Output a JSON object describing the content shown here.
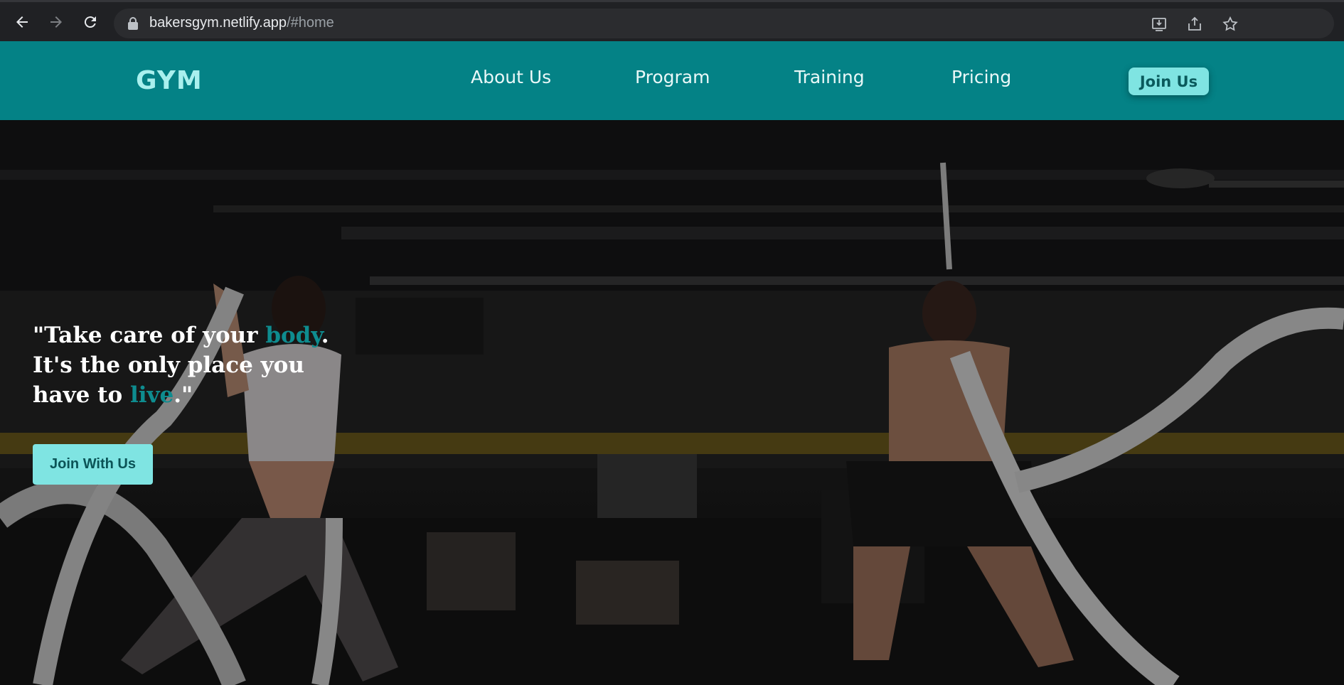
{
  "browser": {
    "url_host": "bakersgym.netlify.app",
    "url_path": "/#home"
  },
  "header": {
    "logo": "GYM",
    "nav": [
      {
        "label": "About Us"
      },
      {
        "label": "Program"
      },
      {
        "label": "Training"
      },
      {
        "label": "Pricing"
      }
    ],
    "join_button": "Join Us"
  },
  "hero": {
    "quote": {
      "line1_pre": "\"Take care of your ",
      "line1_hl": "body",
      "line1_post": ".",
      "line2": "It's the only place you",
      "line3_pre": "have to ",
      "line3_hl": "live",
      "line3_post": ".\""
    },
    "cta_label": "Join With Us"
  },
  "colors": {
    "header_bg": "#048286",
    "accent": "#7fe4e2",
    "highlight": "#0e8c8f"
  },
  "icons": [
    "back-icon",
    "forward-icon",
    "reload-icon",
    "lock-icon",
    "install-icon",
    "share-icon",
    "star-icon",
    "sidebar-icon",
    "avatar",
    "menu-icon"
  ]
}
